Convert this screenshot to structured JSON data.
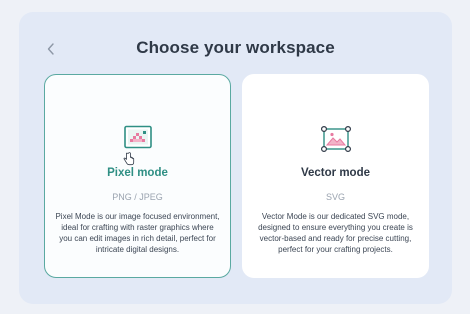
{
  "header": {
    "back_icon": "chevron-left-icon",
    "title": "Choose your workspace"
  },
  "cards": [
    {
      "icon": "pixel-image-icon",
      "title": "Pixel mode",
      "subtitle": "PNG / JPEG",
      "description": "Pixel Mode is our image focused environment, ideal for crafting with raster graphics where you can edit images in rich detail, perfect for intricate digital designs.",
      "selected": true,
      "accent": "#2f8f84"
    },
    {
      "icon": "vector-image-icon",
      "title": "Vector mode",
      "subtitle": "SVG",
      "description": "Vector Mode is our dedicated SVG mode, designed to ensure everything you create is vector-based and ready for precise cutting, perfect for your crafting projects.",
      "selected": false,
      "accent": "#2f8f84"
    }
  ],
  "colors": {
    "background": "#e2e9f6",
    "accent": "#2f8f84",
    "heading": "#2f3947"
  }
}
